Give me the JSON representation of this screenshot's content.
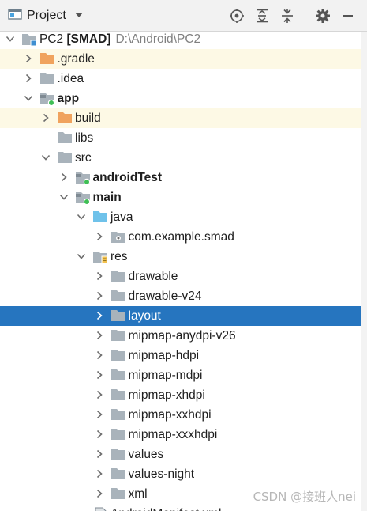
{
  "toolbar": {
    "title": "Project",
    "icons": [
      "project-view-icon",
      "dropdown-chevron-icon",
      "locate-icon",
      "expand-all-icon",
      "collapse-all-icon",
      "gear-icon",
      "minimize-icon"
    ]
  },
  "tree": {
    "root": {
      "name": "PC2",
      "module": "[SMAD]",
      "path": "D:\\Android\\PC2"
    },
    "rows": [
      {
        "label": "PC2"
      },
      {
        "label": ".gradle"
      },
      {
        "label": ".idea"
      },
      {
        "label": "app"
      },
      {
        "label": "build"
      },
      {
        "label": "libs"
      },
      {
        "label": "src"
      },
      {
        "label": "androidTest"
      },
      {
        "label": "main"
      },
      {
        "label": "java"
      },
      {
        "label": "com.example.smad"
      },
      {
        "label": "res"
      },
      {
        "label": "drawable"
      },
      {
        "label": "drawable-v24"
      },
      {
        "label": "layout"
      },
      {
        "label": "mipmap-anydpi-v26"
      },
      {
        "label": "mipmap-hdpi"
      },
      {
        "label": "mipmap-mdpi"
      },
      {
        "label": "mipmap-xhdpi"
      },
      {
        "label": "mipmap-xxhdpi"
      },
      {
        "label": "mipmap-xxxhdpi"
      },
      {
        "label": "values"
      },
      {
        "label": "values-night"
      },
      {
        "label": "xml"
      },
      {
        "label": "AndroidManifest.xml"
      }
    ]
  },
  "watermark": "CSDN @接班人nei",
  "colors": {
    "selection": "#2675bf",
    "highlight": "#fdf9e5",
    "folder_gray": "#a9b3bb",
    "folder_orange": "#f0a35e",
    "folder_blue": "#6fc2ea",
    "module_dot": "#3fbf55"
  }
}
